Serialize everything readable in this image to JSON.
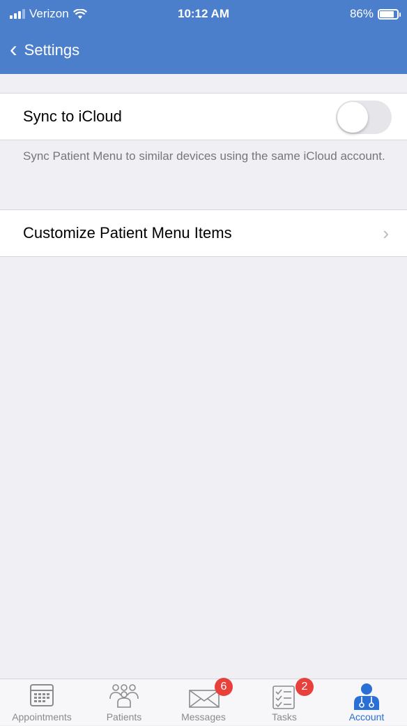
{
  "status_bar": {
    "carrier": "Verizon",
    "time": "10:12 AM",
    "battery": "86%"
  },
  "nav": {
    "back_label": "Settings"
  },
  "settings": {
    "sync": {
      "label": "Sync to iCloud",
      "enabled": false
    },
    "sync_footer": "Sync Patient Menu to similar devices using the same iCloud account.",
    "customize": {
      "label": "Customize Patient Menu Items"
    }
  },
  "tabs": [
    {
      "label": "Appointments",
      "icon": "calendar-icon"
    },
    {
      "label": "Patients",
      "icon": "patients-icon"
    },
    {
      "label": "Messages",
      "icon": "envelope-icon",
      "badge": "6"
    },
    {
      "label": "Tasks",
      "icon": "checklist-icon",
      "badge": "2"
    },
    {
      "label": "Account",
      "icon": "doctor-icon",
      "active": true
    }
  ],
  "colors": {
    "header": "#4b7fcb",
    "active_tab": "#2a6fd6",
    "badge": "#e8413c"
  }
}
